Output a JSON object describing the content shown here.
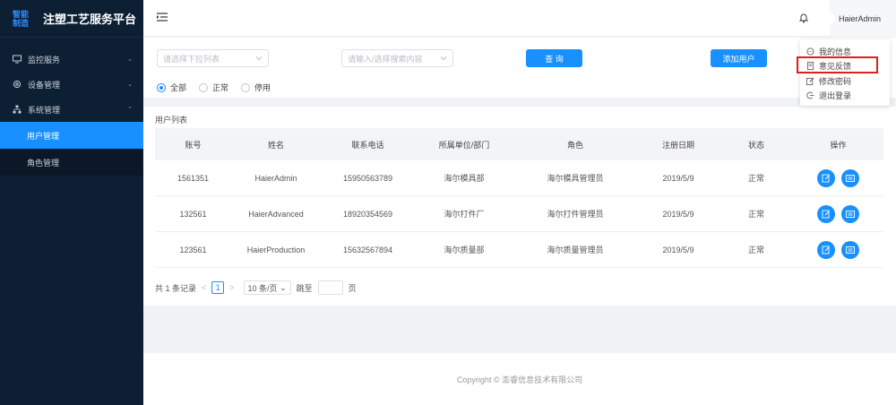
{
  "brand": {
    "logo_line1": "智能",
    "logo_line2": "制造",
    "title": "注塑工艺服务平台"
  },
  "sidebar": {
    "items": [
      {
        "label": "监控服务",
        "icon": "monitor-icon"
      },
      {
        "label": "设备管理",
        "icon": "settings-icon"
      },
      {
        "label": "系统管理",
        "icon": "sitemap-icon"
      }
    ],
    "subitems": [
      {
        "label": "用户管理",
        "active": true
      },
      {
        "label": "角色管理",
        "active": false
      }
    ]
  },
  "header": {
    "username": "HaierAdmin"
  },
  "user_menu": {
    "items": [
      {
        "label": "我的信息",
        "icon": "chat-icon"
      },
      {
        "label": "意见反馈",
        "icon": "feedback-icon"
      },
      {
        "label": "修改密码",
        "icon": "edit-icon"
      },
      {
        "label": "退出登录",
        "icon": "logout-icon"
      }
    ]
  },
  "filter": {
    "select_placeholder": "请选择下拉列表",
    "search_placeholder": "请输入/选择搜索内容",
    "query_label": "查 询",
    "add_user_label": "添加用户",
    "radios": [
      {
        "label": "全部",
        "checked": true
      },
      {
        "label": "正常",
        "checked": false
      },
      {
        "label": "停用",
        "checked": false
      }
    ]
  },
  "table": {
    "title": "用户列表",
    "columns": [
      "账号",
      "姓名",
      "联系电话",
      "所属单位/部门",
      "角色",
      "注册日期",
      "状态",
      "操作"
    ],
    "rows": [
      [
        "1561351",
        "HaierAdmin",
        "15950563789",
        "海尔模具部",
        "海尔模具管理员",
        "2019/5/9",
        "正常"
      ],
      [
        "132561",
        "HaierAdvanced",
        "18920354569",
        "海尔打件厂",
        "海尔打件管理员",
        "2019/5/9",
        "正常"
      ],
      [
        "123561",
        "HaierProduction",
        "15632567894",
        "海尔质量部",
        "海尔质量管理员",
        "2019/5/9",
        "正常"
      ]
    ]
  },
  "pagination": {
    "total_text": "共 1 条记录",
    "prev": "<",
    "current_page": "1",
    "next": ">",
    "page_size": "10 条/页",
    "jump_label": "跳至",
    "page_suffix": "页"
  },
  "footer": {
    "text": "Copyright © 澎睿信息技术有限公司"
  },
  "colors": {
    "primary": "#1890ff",
    "sidebar": "#0d1f33",
    "highlight": "#e02020"
  }
}
